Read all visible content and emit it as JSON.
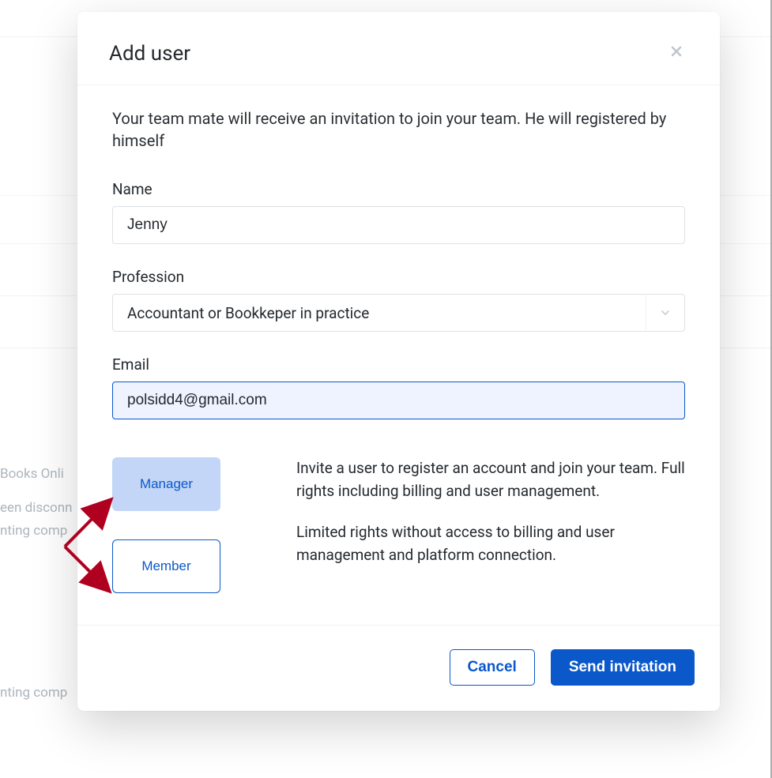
{
  "background": {
    "text1": "Books Onli",
    "text2": "een disconn",
    "text3": "nting comp",
    "text4": "nting comp"
  },
  "modal": {
    "title": "Add user",
    "intro": "Your team mate will receive an invitation to join your team. He will registered by himself",
    "fields": {
      "name": {
        "label": "Name",
        "value": "Jenny"
      },
      "profession": {
        "label": "Profession",
        "value": "Accountant or Bookkeper in practice"
      },
      "email": {
        "label": "Email",
        "value": "polsidd4@gmail.com"
      }
    },
    "roles": {
      "manager": {
        "label": "Manager",
        "description": "Invite a user to register an account and join your team. Full rights including billing and user management."
      },
      "member": {
        "label": "Member",
        "description": "Limited rights without access to billing and user management and platform connection."
      }
    },
    "footer": {
      "cancel": "Cancel",
      "submit": "Send invitation"
    }
  }
}
